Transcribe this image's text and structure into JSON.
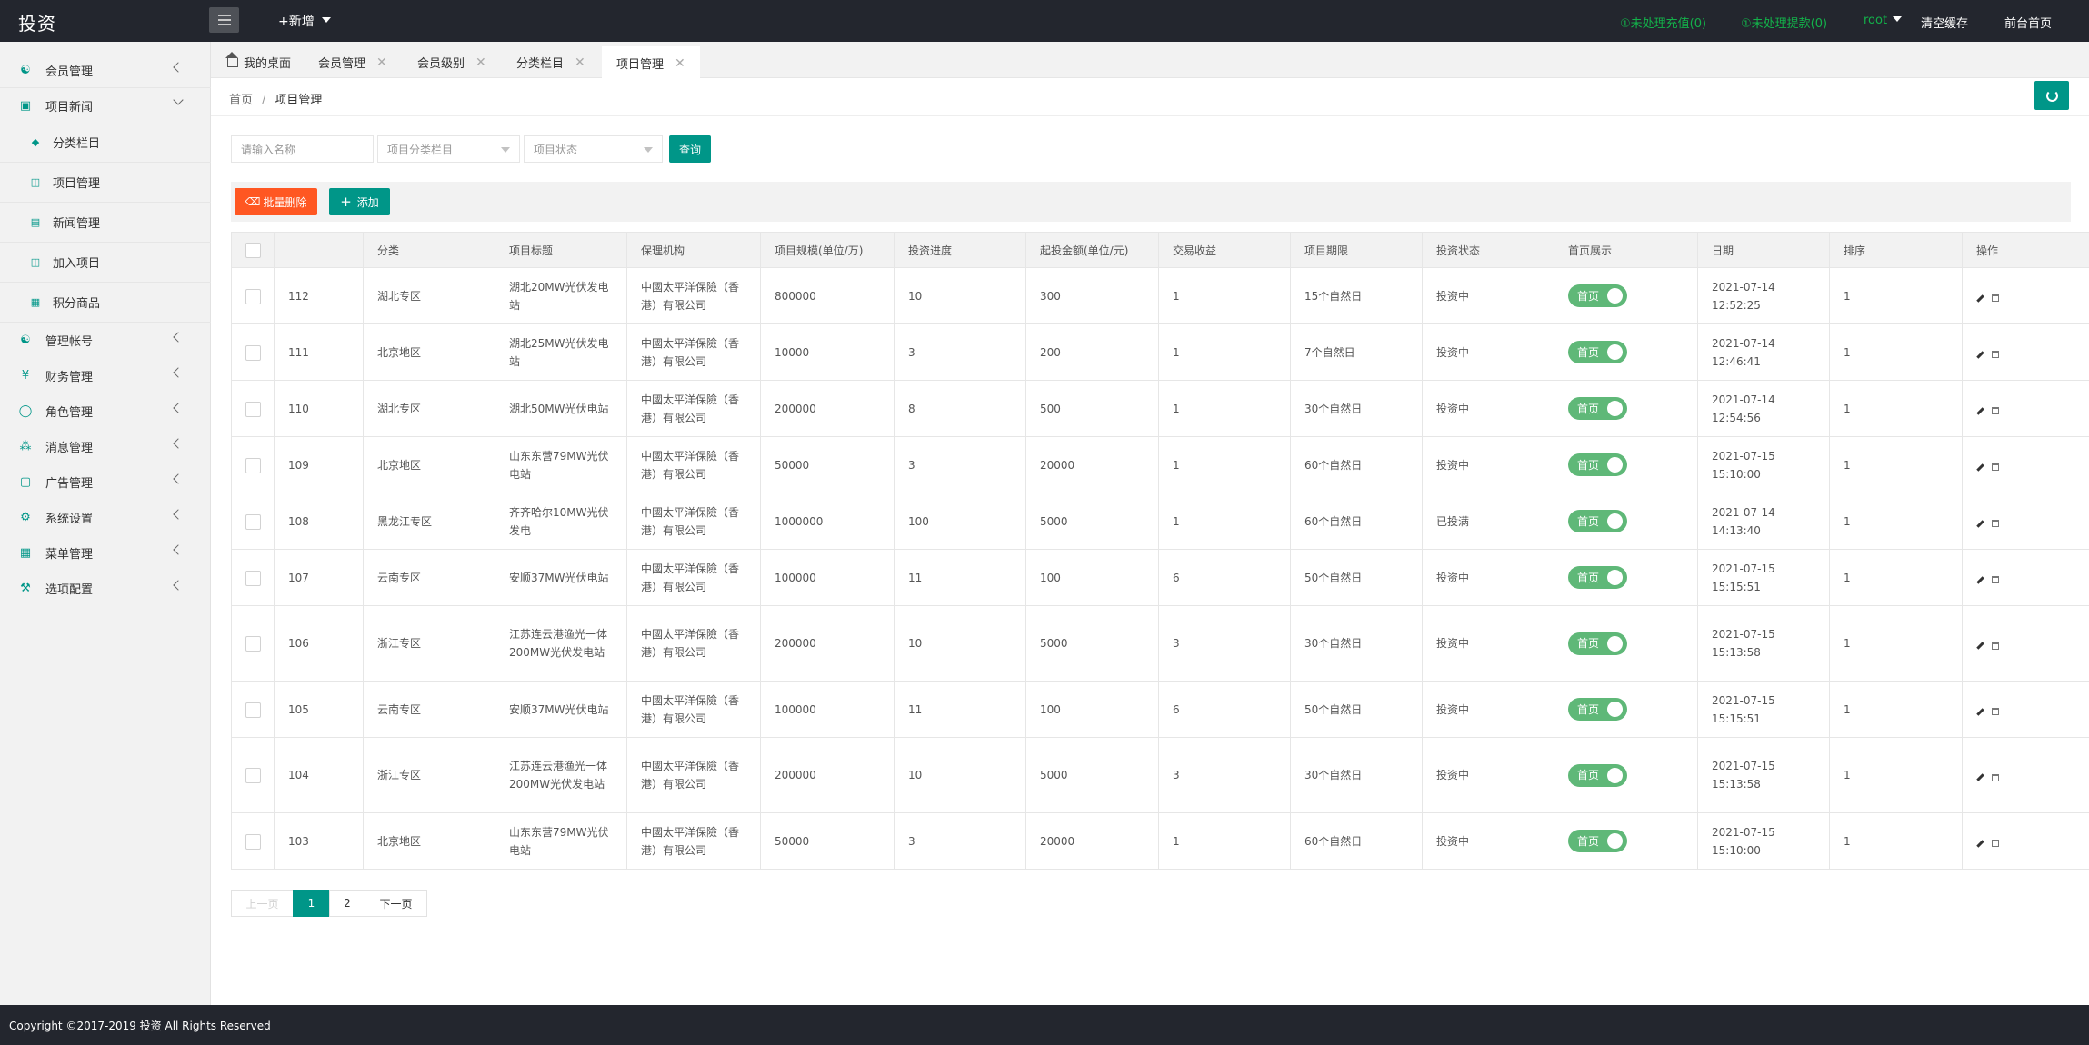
{
  "app": {
    "title": "投资"
  },
  "topbar": {
    "new_label": "+新增",
    "recharge_label": "①未处理充值(0)",
    "withdraw_label": "①未处理提款(0)",
    "user_label": "root",
    "clear_cache_label": "清空缓存",
    "frontend_label": "前台首页"
  },
  "sidebar": {
    "items": [
      {
        "label": "会员管理",
        "icon": "user-icon"
      },
      {
        "label": "项目新闻",
        "icon": "building-icon"
      },
      {
        "label": "分类栏目",
        "icon": "leaf-icon"
      },
      {
        "label": "项目管理",
        "icon": "cart-icon"
      },
      {
        "label": "新闻管理",
        "icon": "news-icon"
      },
      {
        "label": "加入项目",
        "icon": "cart-icon"
      },
      {
        "label": "积分商品",
        "icon": "doc-icon"
      },
      {
        "label": "管理帐号",
        "icon": "users-icon"
      },
      {
        "label": "财务管理",
        "icon": "yen-icon"
      },
      {
        "label": "角色管理",
        "icon": "shield-icon"
      },
      {
        "label": "消息管理",
        "icon": "message-icon"
      },
      {
        "label": "广告管理",
        "icon": "ad-icon"
      },
      {
        "label": "系统设置",
        "icon": "gear-icon"
      },
      {
        "label": "菜单管理",
        "icon": "menu-icon"
      },
      {
        "label": "选项配置",
        "icon": "tool-icon"
      }
    ]
  },
  "tabs": [
    {
      "label": "我的桌面"
    },
    {
      "label": "会员管理"
    },
    {
      "label": "会员级别"
    },
    {
      "label": "分类栏目"
    },
    {
      "label": "项目管理"
    }
  ],
  "breadcrumb": {
    "home": "首页",
    "sep": "/",
    "current": "项目管理"
  },
  "search": {
    "name_placeholder": "请输入名称",
    "category_placeholder": "项目分类栏目",
    "status_placeholder": "项目状态",
    "query_label": "查询"
  },
  "toolbar": {
    "batch_delete_label": "批量删除",
    "add_label": "添加"
  },
  "table": {
    "headers": [
      "分类",
      "项目标题",
      "保理机构",
      "项目规模(单位/万)",
      "投资进度",
      "起投金额(单位/元)",
      "交易收益",
      "项目期限",
      "投资状态",
      "首页展示",
      "日期",
      "排序",
      "操作"
    ],
    "rows": [
      {
        "id": "112",
        "category": "湖北专区",
        "title": "湖北20MW光伏发电站",
        "org": "中國太平洋保險（香港）有限公司",
        "scale": "800000",
        "progress": "10",
        "min_amount": "300",
        "yield": "1",
        "term": "15个自然日",
        "status": "投资中",
        "home": "首页",
        "date": "2021-07-14 12:52:25",
        "sort": "1"
      },
      {
        "id": "111",
        "category": "北京地区",
        "title": "湖北25MW光伏发电站",
        "org": "中國太平洋保險（香港）有限公司",
        "scale": "10000",
        "progress": "3",
        "min_amount": "200",
        "yield": "1",
        "term": "7个自然日",
        "status": "投资中",
        "home": "首页",
        "date": "2021-07-14 12:46:41",
        "sort": "1"
      },
      {
        "id": "110",
        "category": "湖北专区",
        "title": "湖北50MW光伏电站",
        "org": "中國太平洋保險（香港）有限公司",
        "scale": "200000",
        "progress": "8",
        "min_amount": "500",
        "yield": "1",
        "term": "30个自然日",
        "status": "投资中",
        "home": "首页",
        "date": "2021-07-14 12:54:56",
        "sort": "1"
      },
      {
        "id": "109",
        "category": "北京地区",
        "title": "山东东营79MW光伏电站",
        "org": "中國太平洋保險（香港）有限公司",
        "scale": "50000",
        "progress": "3",
        "min_amount": "20000",
        "yield": "1",
        "term": "60个自然日",
        "status": "投资中",
        "home": "首页",
        "date": "2021-07-15 15:10:00",
        "sort": "1"
      },
      {
        "id": "108",
        "category": "黑龙江专区",
        "title": "齐齐哈尔10MW光伏发电",
        "org": "中國太平洋保險（香港）有限公司",
        "scale": "1000000",
        "progress": "100",
        "min_amount": "5000",
        "yield": "1",
        "term": "60个自然日",
        "status": "已投满",
        "home": "首页",
        "date": "2021-07-14 14:13:40",
        "sort": "1"
      },
      {
        "id": "107",
        "category": "云南专区",
        "title": "安顺37MW光伏电站",
        "org": "中國太平洋保險（香港）有限公司",
        "scale": "100000",
        "progress": "11",
        "min_amount": "100",
        "yield": "6",
        "term": "50个自然日",
        "status": "投资中",
        "home": "首页",
        "date": "2021-07-15 15:15:51",
        "sort": "1"
      },
      {
        "id": "106",
        "category": "浙江专区",
        "title": "江苏连云港渔光一体200MW光伏发电站",
        "org": "中國太平洋保險（香港）有限公司",
        "scale": "200000",
        "progress": "10",
        "min_amount": "5000",
        "yield": "3",
        "term": "30个自然日",
        "status": "投资中",
        "home": "首页",
        "date": "2021-07-15 15:13:58",
        "sort": "1"
      },
      {
        "id": "105",
        "category": "云南专区",
        "title": "安顺37MW光伏电站",
        "org": "中國太平洋保險（香港）有限公司",
        "scale": "100000",
        "progress": "11",
        "min_amount": "100",
        "yield": "6",
        "term": "50个自然日",
        "status": "投资中",
        "home": "首页",
        "date": "2021-07-15 15:15:51",
        "sort": "1"
      },
      {
        "id": "104",
        "category": "浙江专区",
        "title": "江苏连云港渔光一体200MW光伏发电站",
        "org": "中國太平洋保險（香港）有限公司",
        "scale": "200000",
        "progress": "10",
        "min_amount": "5000",
        "yield": "3",
        "term": "30个自然日",
        "status": "投资中",
        "home": "首页",
        "date": "2021-07-15 15:13:58",
        "sort": "1"
      },
      {
        "id": "103",
        "category": "北京地区",
        "title": "山东东营79MW光伏电站",
        "org": "中國太平洋保險（香港）有限公司",
        "scale": "50000",
        "progress": "3",
        "min_amount": "20000",
        "yield": "1",
        "term": "60个自然日",
        "status": "投资中",
        "home": "首页",
        "date": "2021-07-15 15:10:00",
        "sort": "1"
      }
    ]
  },
  "pagination": {
    "prev": "上一页",
    "pages": [
      "1",
      "2"
    ],
    "current": "1",
    "next": "下一页"
  },
  "footer": {
    "text": "Copyright ©2017-2019 投资 All Rights Reserved"
  },
  "colors": {
    "accent": "#009688",
    "danger": "#ff5722",
    "switch_on": "#5fb878",
    "dark_bar": "#23262e"
  }
}
